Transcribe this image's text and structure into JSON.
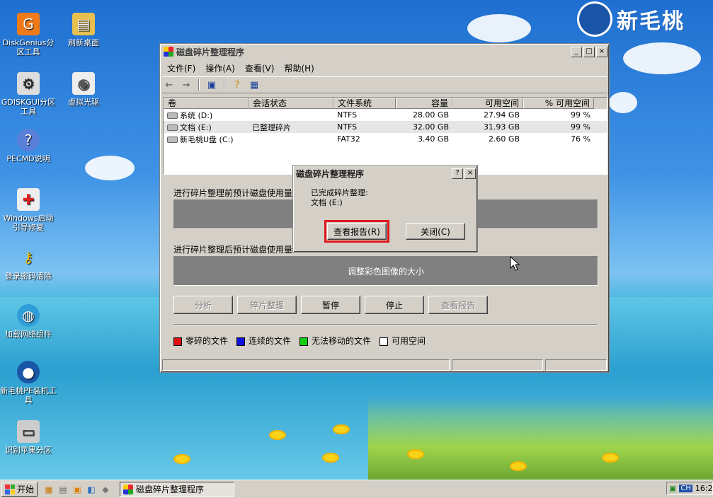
{
  "brand": {
    "logo_text": "新毛桃"
  },
  "desktop_icons": [
    {
      "label": "DiskGenius分区工具",
      "icon": "diskgenius-icon"
    },
    {
      "label": "刷新桌面",
      "icon": "refresh-desktop-icon"
    },
    {
      "label": "GDISKGUI分区工具",
      "icon": "gdisk-icon"
    },
    {
      "label": "虚拟光驱",
      "icon": "virtual-drive-icon"
    },
    {
      "label": "PECMD说明",
      "icon": "help-icon"
    },
    {
      "label": "Windows启动引导修复",
      "icon": "boot-repair-icon"
    },
    {
      "label": "登录密码清除",
      "icon": "key-icon"
    },
    {
      "label": "加载网络组件",
      "icon": "network-icon"
    },
    {
      "label": "新毛桃PE装机工具",
      "icon": "installer-icon"
    },
    {
      "label": "识别苹果分区",
      "icon": "apple-partition-icon"
    }
  ],
  "window": {
    "title": "磁盘碎片整理程序",
    "controls": {
      "minimize": "_",
      "maximize": "□",
      "close": "×"
    },
    "menu": [
      "文件(F)",
      "操作(A)",
      "查看(V)",
      "帮助(H)"
    ],
    "columns": [
      "卷",
      "会话状态",
      "文件系统",
      "容量",
      "可用空间",
      "% 可用空间"
    ],
    "volumes": [
      {
        "name": "系统 (D:)",
        "status": "",
        "fs": "NTFS",
        "capacity": "28.00 GB",
        "free": "27.94 GB",
        "pct": "99 %"
      },
      {
        "name": "文档 (E:)",
        "status": "已整理碎片",
        "fs": "NTFS",
        "capacity": "32.00 GB",
        "free": "31.93 GB",
        "pct": "99 %"
      },
      {
        "name": "新毛桃U盘 (C:)",
        "status": "",
        "fs": "FAT32",
        "capacity": "3.40 GB",
        "free": "2.60 GB",
        "pct": "76 %"
      }
    ],
    "before_label": "进行碎片整理前预计磁盘使用量",
    "after_label": "进行碎片整理后预计磁盘使用量",
    "after_bar_text": "调整彩色图像的大小",
    "buttons": {
      "analyze": "分析",
      "defrag": "碎片整理",
      "pause": "暂停",
      "stop": "停止",
      "report": "查看报告"
    },
    "legend": [
      {
        "label": "零碎的文件",
        "color": "#e01010"
      },
      {
        "label": "连续的文件",
        "color": "#1010e0"
      },
      {
        "label": "无法移动的文件",
        "color": "#10d010"
      },
      {
        "label": "可用空间",
        "color": "#ffffff"
      }
    ]
  },
  "dialog": {
    "title": "磁盘碎片整理程序",
    "help": "?",
    "close": "×",
    "message_line1": "已完成碎片整理:",
    "message_line2": "文档 (E:)",
    "view_report": "查看报告(R)",
    "close_button": "关闭(C)"
  },
  "taskbar": {
    "start": "开始",
    "task": "磁盘碎片整理程序",
    "ime": "CH",
    "clock": "16:2"
  }
}
